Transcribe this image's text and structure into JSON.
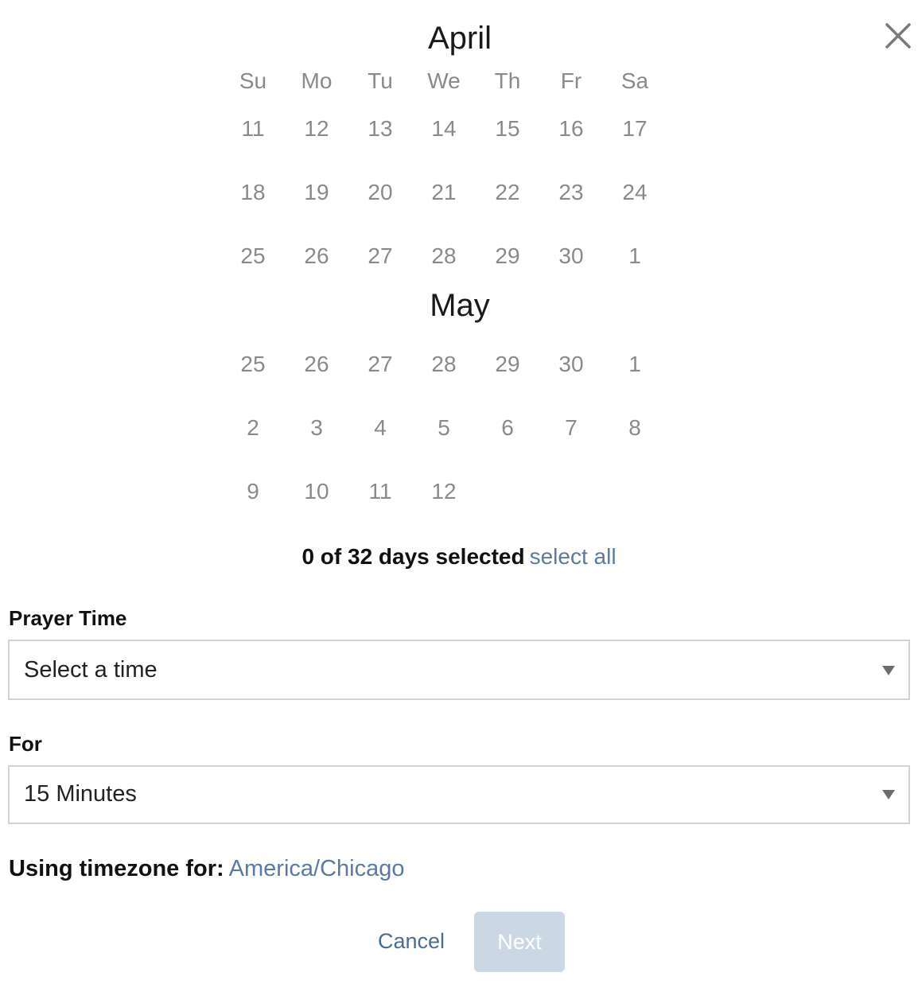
{
  "dialog": {
    "close_icon": "close-icon"
  },
  "calendar": {
    "weekdays": [
      "Su",
      "Mo",
      "Tu",
      "We",
      "Th",
      "Fr",
      "Sa"
    ],
    "months": [
      {
        "name": "April",
        "weeks": [
          [
            "11",
            "12",
            "13",
            "14",
            "15",
            "16",
            "17"
          ],
          [
            "18",
            "19",
            "20",
            "21",
            "22",
            "23",
            "24"
          ],
          [
            "25",
            "26",
            "27",
            "28",
            "29",
            "30",
            "1"
          ]
        ]
      },
      {
        "name": "May",
        "weeks": [
          [
            "25",
            "26",
            "27",
            "28",
            "29",
            "30",
            "1"
          ],
          [
            "2",
            "3",
            "4",
            "5",
            "6",
            "7",
            "8"
          ],
          [
            "9",
            "10",
            "11",
            "12",
            "",
            "",
            ""
          ]
        ]
      }
    ]
  },
  "selection": {
    "summary": "0 of 32 days selected",
    "select_all_label": "select all"
  },
  "prayer_time": {
    "label": "Prayer Time",
    "value": "Select a time"
  },
  "duration": {
    "label": "For",
    "value": "15 Minutes"
  },
  "timezone": {
    "label": "Using timezone for:",
    "value": "America/Chicago"
  },
  "actions": {
    "cancel_label": "Cancel",
    "next_label": "Next"
  },
  "colors": {
    "link": "#5b7aa3",
    "day_text": "#8a8a8a",
    "next_disabled_bg": "#ccd7e4"
  }
}
